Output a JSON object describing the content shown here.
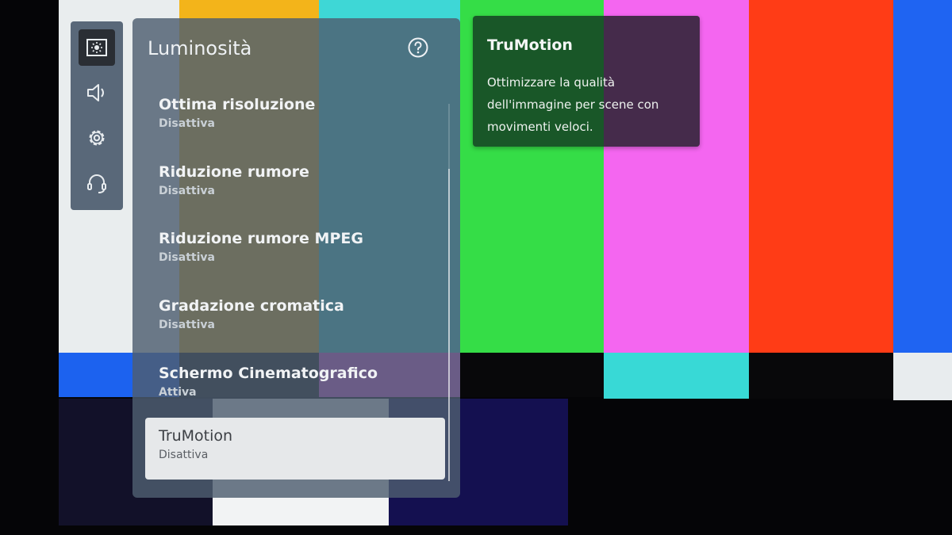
{
  "background": {
    "top_colors": [
      "#e9edee",
      "#f3b41a",
      "#3ed7d6",
      "#35dd47",
      "#f466f0",
      "#ff3c16",
      "#1f64f2"
    ]
  },
  "sidebar": {
    "icons": [
      "brightness-icon",
      "speaker-icon",
      "settings-gear-icon",
      "headset-support-icon"
    ],
    "active_index": 0
  },
  "panel": {
    "title": "Luminosità",
    "items": [
      {
        "label": "Ottima risoluzione",
        "value": "Disattiva"
      },
      {
        "label": "Riduzione rumore",
        "value": "Disattiva"
      },
      {
        "label": "Riduzione rumore MPEG",
        "value": "Disattiva"
      },
      {
        "label": "Gradazione cromatica",
        "value": "Disattiva"
      },
      {
        "label": "Schermo Cinematografico",
        "value": "Attiva"
      },
      {
        "label": "TruMotion",
        "value": "Disattiva"
      }
    ],
    "selected_index": 5
  },
  "tooltip": {
    "title": "TruMotion",
    "body": "Ottimizzare la qualità dell'immagine per scene con movimenti veloci."
  }
}
